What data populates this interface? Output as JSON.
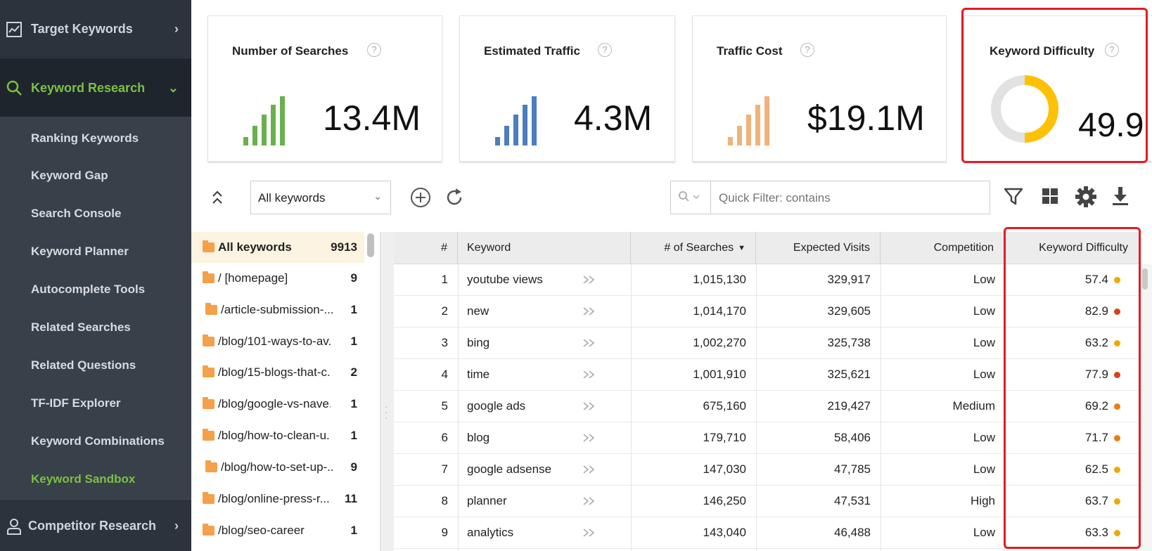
{
  "sidebar": {
    "target_keywords": "Target Keywords",
    "keyword_research": "Keyword Research",
    "competitor_research": "Competitor Research",
    "items": [
      {
        "label": "Ranking Keywords"
      },
      {
        "label": "Keyword Gap"
      },
      {
        "label": "Search Console"
      },
      {
        "label": "Keyword Planner"
      },
      {
        "label": "Autocomplete Tools"
      },
      {
        "label": "Related Searches"
      },
      {
        "label": "Related Questions"
      },
      {
        "label": "TF-IDF Explorer"
      },
      {
        "label": "Keyword Combinations"
      },
      {
        "label": "Keyword Sandbox"
      }
    ],
    "active_item": "Keyword Sandbox"
  },
  "cards": {
    "searches": {
      "title": "Number of Searches",
      "value": "13.4M",
      "color": "#6ab04c"
    },
    "traffic": {
      "title": "Estimated Traffic",
      "value": "4.3M",
      "color": "#4a7ebf"
    },
    "cost": {
      "title": "Traffic Cost",
      "value": "$19.1M",
      "color": "#f0b27a"
    },
    "difficulty": {
      "title": "Keyword Difficulty",
      "value": "49.9",
      "donut_fraction": 0.499,
      "color": "#ffc107"
    },
    "help_symbol": "?"
  },
  "toolbar": {
    "filter_select": "All keywords",
    "quick_filter_placeholder": "Quick Filter: contains"
  },
  "tree": [
    {
      "name": "All keywords",
      "count": "9913",
      "selected": true
    },
    {
      "name": "/ [homepage]",
      "count": "9"
    },
    {
      "name": "/article-submission-...",
      "count": "1"
    },
    {
      "name": "/blog/101-ways-to-av...",
      "count": "1"
    },
    {
      "name": "/blog/15-blogs-that-c...",
      "count": "2"
    },
    {
      "name": "/blog/google-vs-nave...",
      "count": "1"
    },
    {
      "name": "/blog/how-to-clean-u...",
      "count": "1"
    },
    {
      "name": "/blog/how-to-set-up-...",
      "count": "9"
    },
    {
      "name": "/blog/online-press-r...",
      "count": "11"
    },
    {
      "name": "/blog/seo-career",
      "count": "1"
    }
  ],
  "grid": {
    "headers": {
      "num": "#",
      "keyword": "Keyword",
      "searches": "# of Searches",
      "visits": "Expected Visits",
      "competition": "Competition",
      "difficulty": "Keyword Difficulty"
    },
    "rows": [
      {
        "num": "1",
        "keyword": "youtube views",
        "searches": "1,015,130",
        "visits": "329,917",
        "competition": "Low",
        "difficulty": "57.4",
        "dot": "#f0a800"
      },
      {
        "num": "2",
        "keyword": "new",
        "searches": "1,014,170",
        "visits": "329,605",
        "competition": "Low",
        "difficulty": "82.9",
        "dot": "#d9401a"
      },
      {
        "num": "3",
        "keyword": "bing",
        "searches": "1,002,270",
        "visits": "325,738",
        "competition": "Low",
        "difficulty": "63.2",
        "dot": "#f0a800"
      },
      {
        "num": "4",
        "keyword": "time",
        "searches": "1,001,910",
        "visits": "325,621",
        "competition": "Low",
        "difficulty": "77.9",
        "dot": "#d9401a"
      },
      {
        "num": "5",
        "keyword": "google ads",
        "searches": "675,160",
        "visits": "219,427",
        "competition": "Medium",
        "difficulty": "69.2",
        "dot": "#ee7a10"
      },
      {
        "num": "6",
        "keyword": "blog",
        "searches": "179,710",
        "visits": "58,406",
        "competition": "Low",
        "difficulty": "71.7",
        "dot": "#ee7a10"
      },
      {
        "num": "7",
        "keyword": "google adsense",
        "searches": "147,030",
        "visits": "47,785",
        "competition": "Low",
        "difficulty": "62.5",
        "dot": "#f0a800"
      },
      {
        "num": "8",
        "keyword": "planner",
        "searches": "146,250",
        "visits": "47,531",
        "competition": "High",
        "difficulty": "63.7",
        "dot": "#f0a800"
      },
      {
        "num": "9",
        "keyword": "analytics",
        "searches": "143,040",
        "visits": "46,488",
        "competition": "Low",
        "difficulty": "63.3",
        "dot": "#f0a800"
      }
    ]
  },
  "colors": {
    "highlight_border": "#e31b23",
    "sidebar_active": "#7ac143"
  }
}
